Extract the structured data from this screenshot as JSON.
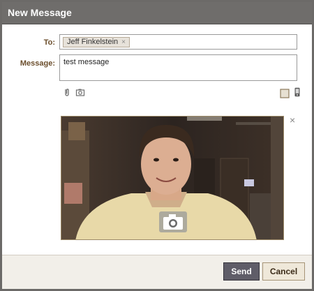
{
  "dialog": {
    "title": "New Message"
  },
  "form": {
    "to_label": "To:",
    "recipient": "Jeff Finkelstein",
    "recipient_remove": "×",
    "message_label": "Message:",
    "message_value": "test message"
  },
  "attachments": {
    "left_icons": [
      "paperclip-icon",
      "camera-icon"
    ],
    "right_icons": [
      "checkbox-icon",
      "mobile-phone-icon"
    ]
  },
  "preview": {
    "close": "×",
    "capture_icon": "camera-icon"
  },
  "footer": {
    "send_label": "Send",
    "cancel_label": "Cancel"
  },
  "colors": {
    "titlebar": "#6f6d6b",
    "label": "#6b4e2c",
    "send_bg": "#5f5d68",
    "cancel_bg": "#efe8d9"
  }
}
